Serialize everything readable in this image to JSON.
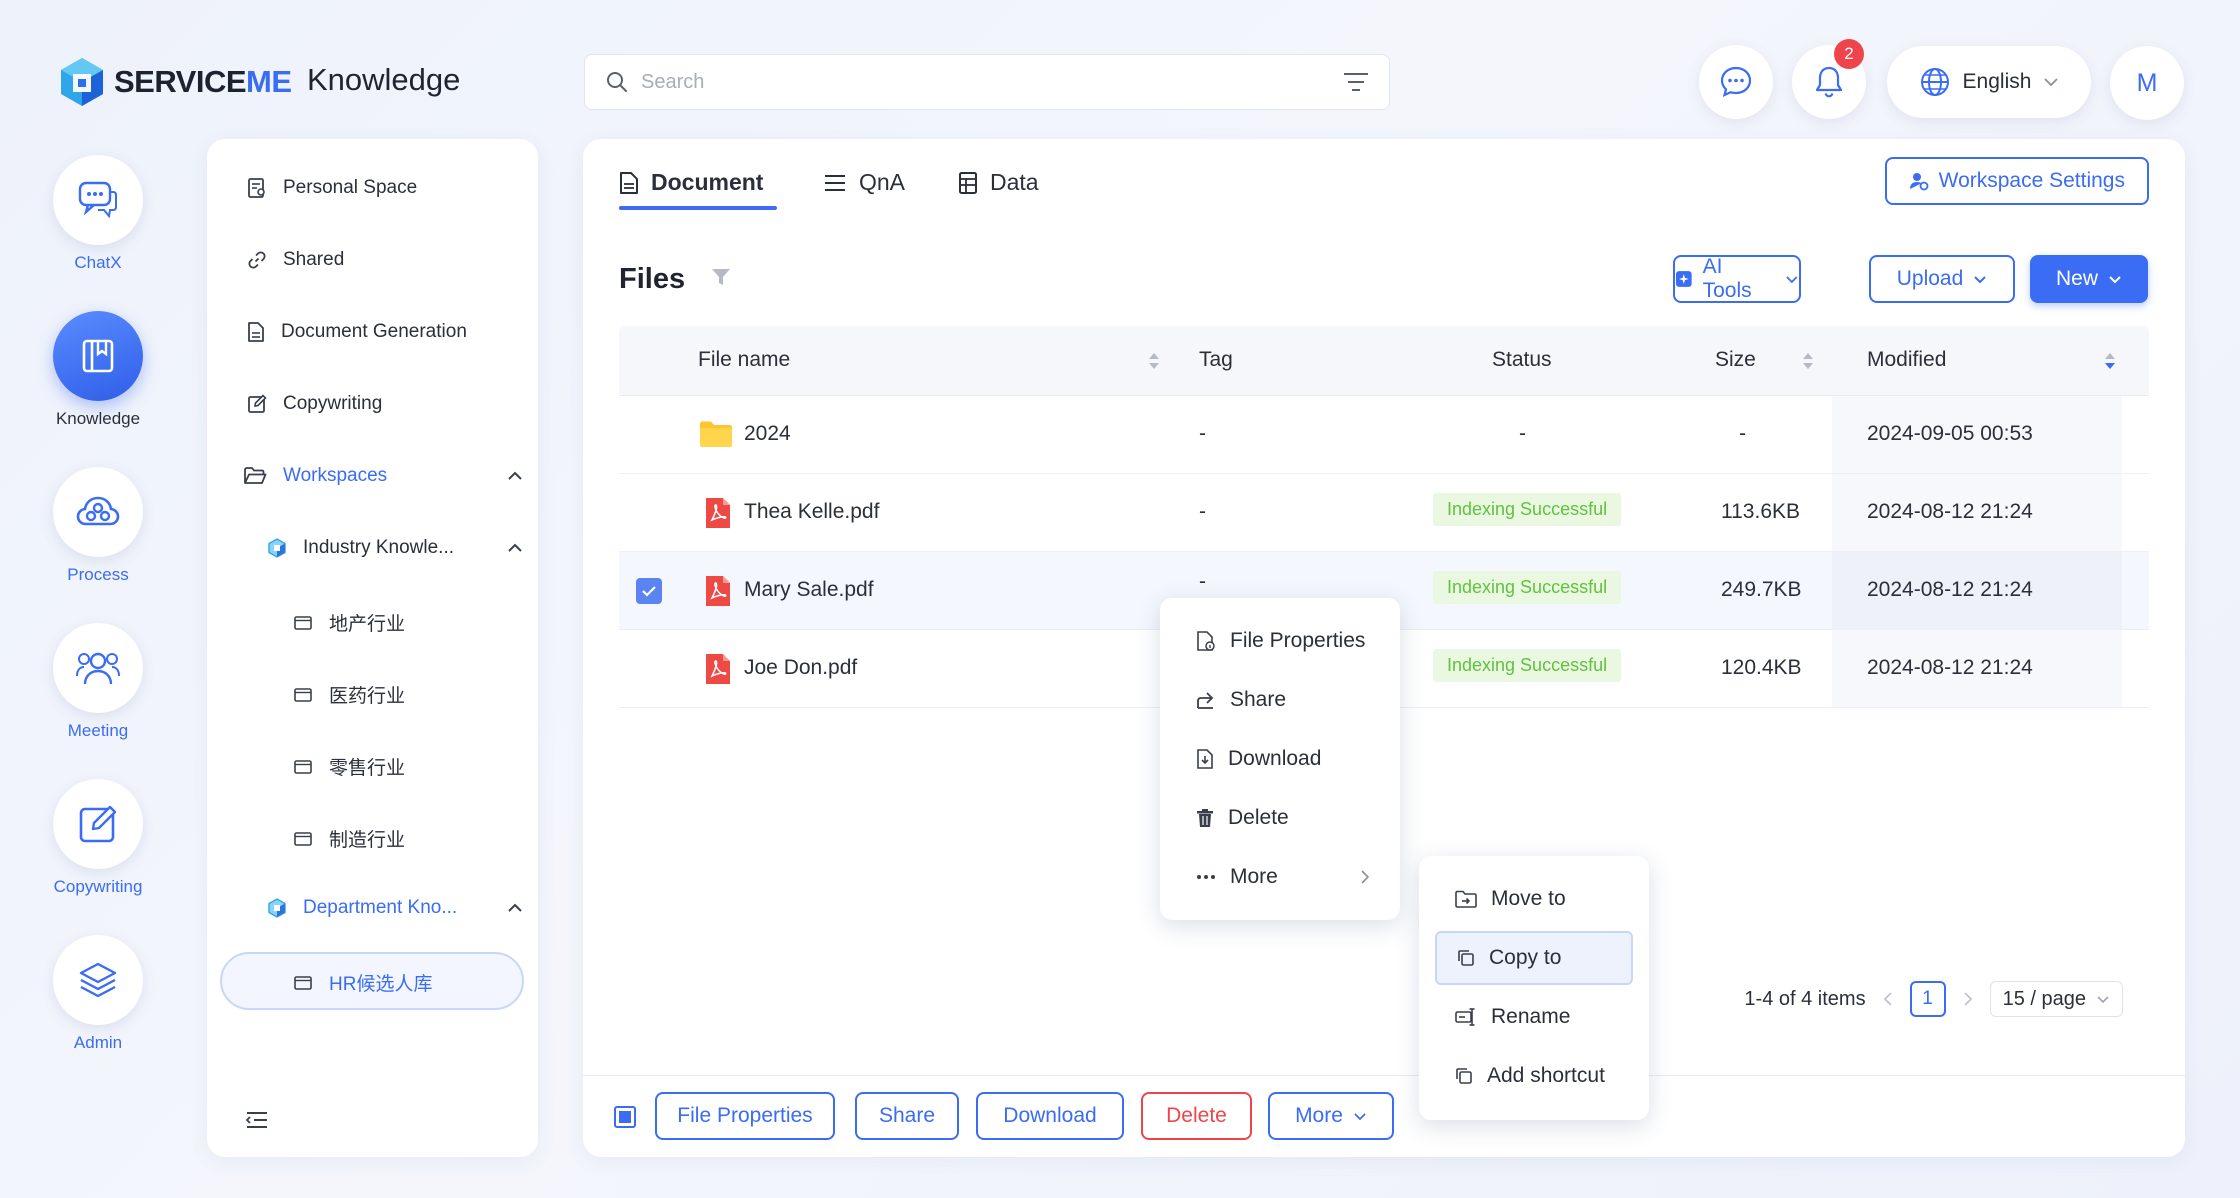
{
  "brand": {
    "logo_text_a": "SERVICE",
    "logo_text_b": "ME",
    "app_title": "Knowledge"
  },
  "search": {
    "placeholder": "Search"
  },
  "header": {
    "notification_count": "2",
    "language": "English",
    "avatar_initial": "M"
  },
  "rail": {
    "items": [
      {
        "label": "ChatX",
        "icon": "chat-icon"
      },
      {
        "label": "Knowledge",
        "icon": "book-icon"
      },
      {
        "label": "Process",
        "icon": "cloud-flow-icon"
      },
      {
        "label": "Meeting",
        "icon": "people-icon"
      },
      {
        "label": "Copywriting",
        "icon": "edit-icon"
      },
      {
        "label": "Admin",
        "icon": "layers-icon"
      }
    ]
  },
  "nav": {
    "personal_space": "Personal Space",
    "shared": "Shared",
    "document_generation": "Document Generation",
    "copywriting": "Copywriting",
    "workspaces": "Workspaces",
    "industry": "Industry Knowle...",
    "industry_children": [
      "地产行业",
      "医药行业",
      "零售行业",
      "制造行业"
    ],
    "department": "Department Kno...",
    "department_children": [
      "HR候选人库"
    ]
  },
  "tabs": {
    "document": "Document",
    "qna": "QnA",
    "data": "Data"
  },
  "workspace_settings": "Workspace Settings",
  "files": {
    "title": "Files",
    "ai_tools": "AI Tools",
    "upload": "Upload",
    "new": "New",
    "columns": {
      "name": "File name",
      "tag": "Tag",
      "status": "Status",
      "size": "Size",
      "modified": "Modified"
    },
    "rows": [
      {
        "name": "2024",
        "tag": "-",
        "status": "-",
        "size": "-",
        "modified": "2024-09-05 00:53"
      },
      {
        "name": "Thea Kelle.pdf",
        "tag": "-",
        "status": "Indexing Successful",
        "size": "113.6KB",
        "modified": "2024-08-12 21:24"
      },
      {
        "name": "Mary Sale.pdf",
        "tag": "-",
        "status": "Indexing Successful",
        "size": "249.7KB",
        "modified": "2024-08-12 21:24"
      },
      {
        "name": "Joe Don.pdf",
        "tag": "-",
        "status": "Indexing Successful",
        "size": "120.4KB",
        "modified": "2024-08-12 21:24"
      }
    ]
  },
  "pagination": {
    "summary": "1-4 of 4 items",
    "page": "1",
    "page_size": "15 / page"
  },
  "bottom_bar": {
    "file_properties": "File Properties",
    "share": "Share",
    "download": "Download",
    "delete": "Delete",
    "more": "More"
  },
  "context_menu": {
    "file_properties": "File Properties",
    "share": "Share",
    "download": "Download",
    "delete": "Delete",
    "more": "More"
  },
  "submenu": {
    "move_to": "Move to",
    "copy_to": "Copy to",
    "rename": "Rename",
    "add_shortcut": "Add shortcut"
  },
  "colors": {
    "accent": "#3a6cf4",
    "danger": "#f0444c",
    "success_text": "#62c13f",
    "success_bg": "#eaf8e2",
    "folder": "#ffc42e",
    "pdf": "#ee4a45"
  }
}
